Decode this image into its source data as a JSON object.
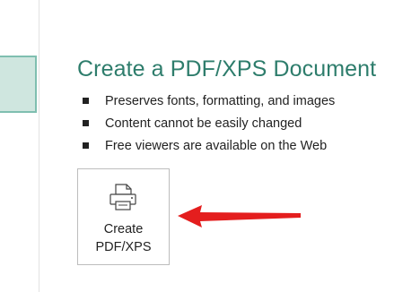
{
  "page": {
    "title": "Create a PDF/XPS Document",
    "bullets": [
      "Preserves fonts, formatting, and images",
      "Content cannot be easily changed",
      "Free viewers are available on the Web"
    ],
    "create_button": {
      "line1": "Create",
      "line2": "PDF/XPS",
      "icon": "document-printer-icon"
    }
  },
  "colors": {
    "title": "#2e7d6c",
    "selected_tile_bg": "#cfe6df",
    "selected_tile_border": "#7fbfb0",
    "arrow": "#e41e1e"
  }
}
